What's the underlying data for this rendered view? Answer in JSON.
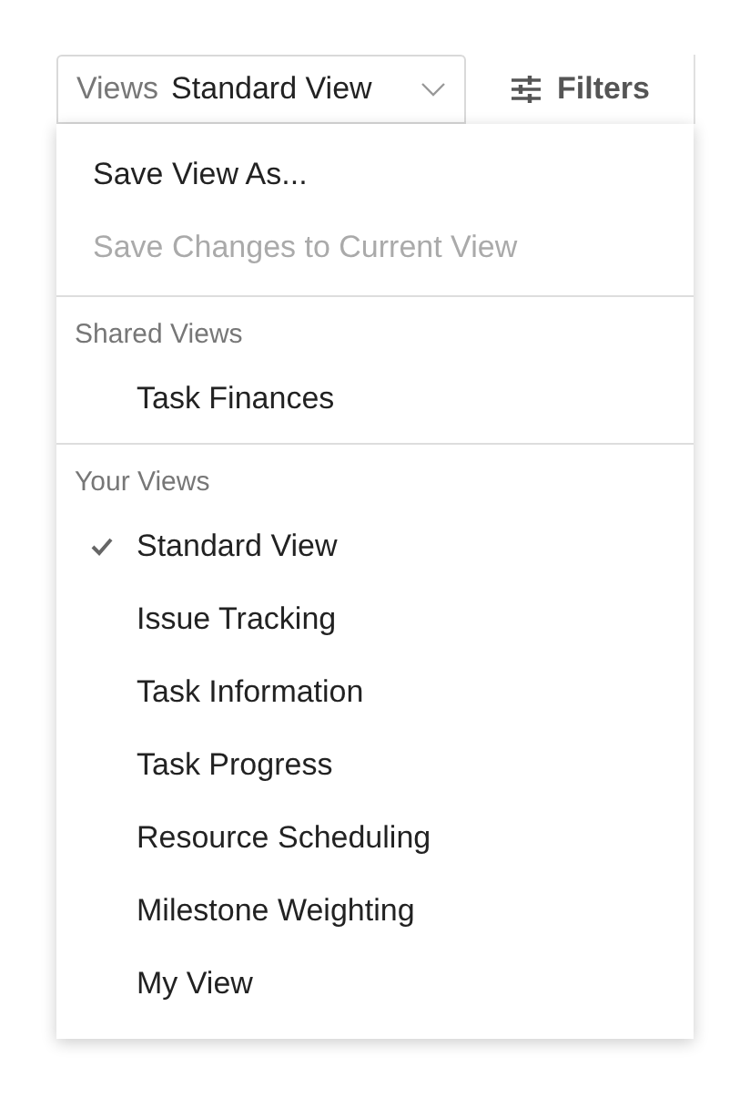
{
  "views_select": {
    "label": "Views",
    "value": "Standard View"
  },
  "filters_button": {
    "label": "Filters"
  },
  "menu": {
    "actions": [
      {
        "label": "Save View As...",
        "disabled": false
      },
      {
        "label": "Save Changes to Current View",
        "disabled": true
      }
    ],
    "sections": [
      {
        "title": "Shared Views",
        "items": [
          {
            "label": "Task Finances",
            "selected": false
          }
        ]
      },
      {
        "title": "Your Views",
        "items": [
          {
            "label": "Standard View",
            "selected": true
          },
          {
            "label": "Issue Tracking",
            "selected": false
          },
          {
            "label": "Task Information",
            "selected": false
          },
          {
            "label": "Task Progress",
            "selected": false
          },
          {
            "label": "Resource Scheduling",
            "selected": false
          },
          {
            "label": "Milestone Weighting",
            "selected": false
          },
          {
            "label": "My View",
            "selected": false
          }
        ]
      }
    ]
  }
}
